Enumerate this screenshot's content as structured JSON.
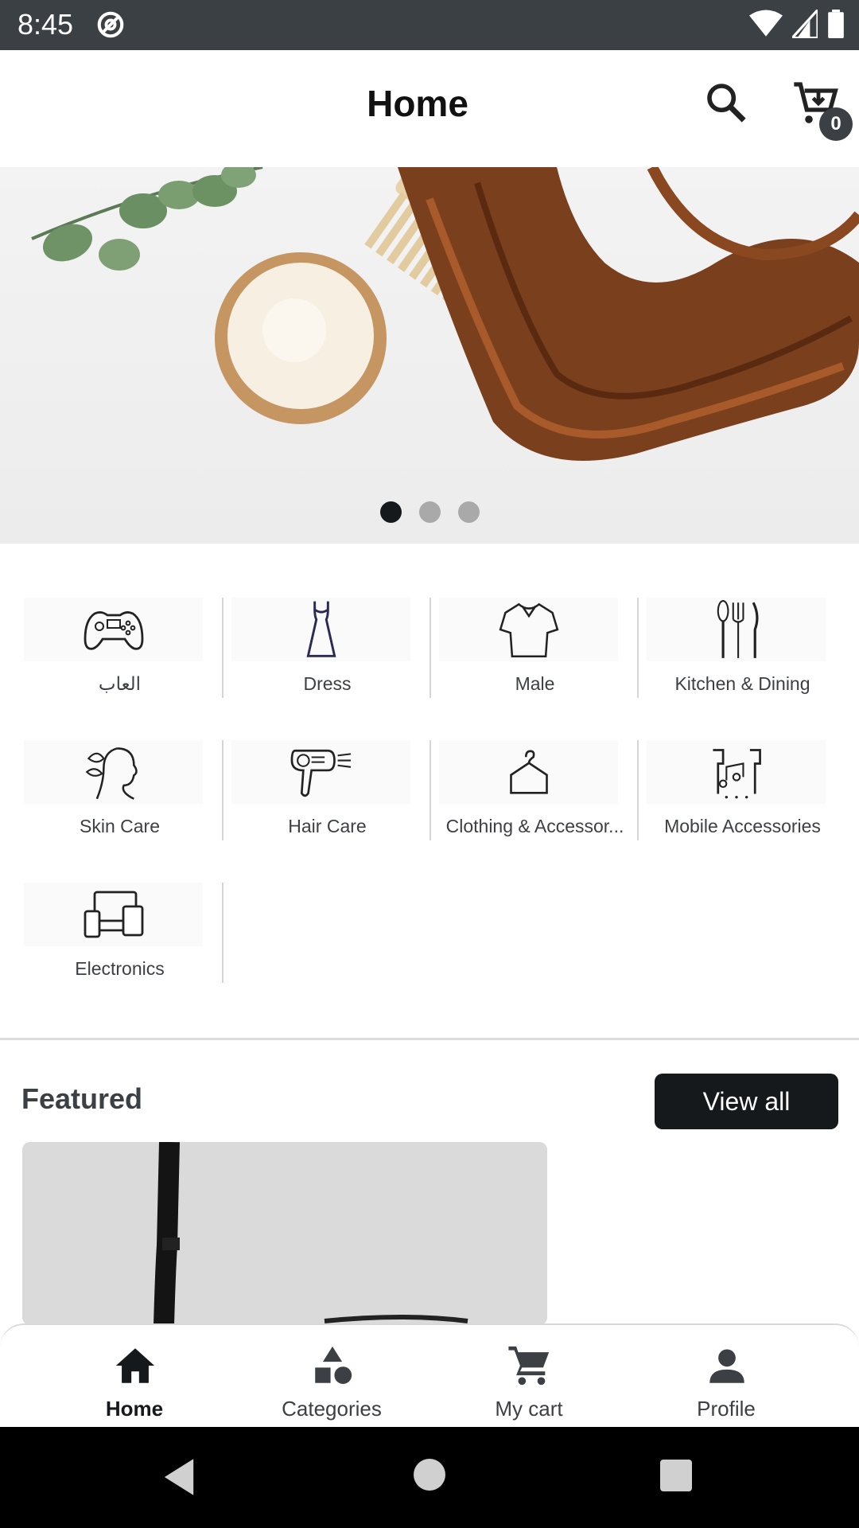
{
  "status_bar": {
    "time": "8:45"
  },
  "app_bar": {
    "title": "Home",
    "cart_count": "0"
  },
  "banner": {
    "slides": 3,
    "active_slide": 1
  },
  "categories": [
    {
      "label": "العاب",
      "icon": "gamepad-icon"
    },
    {
      "label": "Dress",
      "icon": "dress-icon"
    },
    {
      "label": "Male",
      "icon": "shirt-icon"
    },
    {
      "label": "Kitchen & Dining",
      "icon": "utensils-icon"
    },
    {
      "label": "Skin Care",
      "icon": "face-leaf-icon"
    },
    {
      "label": "Hair Care",
      "icon": "hair-dryer-icon"
    },
    {
      "label": "Clothing & Accessor...",
      "icon": "hanger-icon"
    },
    {
      "label": "Mobile Accessories",
      "icon": "earphones-icon"
    },
    {
      "label": "Electronics",
      "icon": "devices-icon"
    }
  ],
  "featured": {
    "title": "Featured",
    "view_all_label": "View all"
  },
  "bottom_nav": [
    {
      "label": "Home",
      "icon": "home-icon",
      "active": true
    },
    {
      "label": "Categories",
      "icon": "shapes-icon",
      "active": false
    },
    {
      "label": "My cart",
      "icon": "cart-icon",
      "active": false
    },
    {
      "label": "Profile",
      "icon": "person-icon",
      "active": false
    }
  ],
  "colors": {
    "primary": "#15191c",
    "status_bar": "#3b4045",
    "dot_inactive": "#a9a9a9"
  }
}
